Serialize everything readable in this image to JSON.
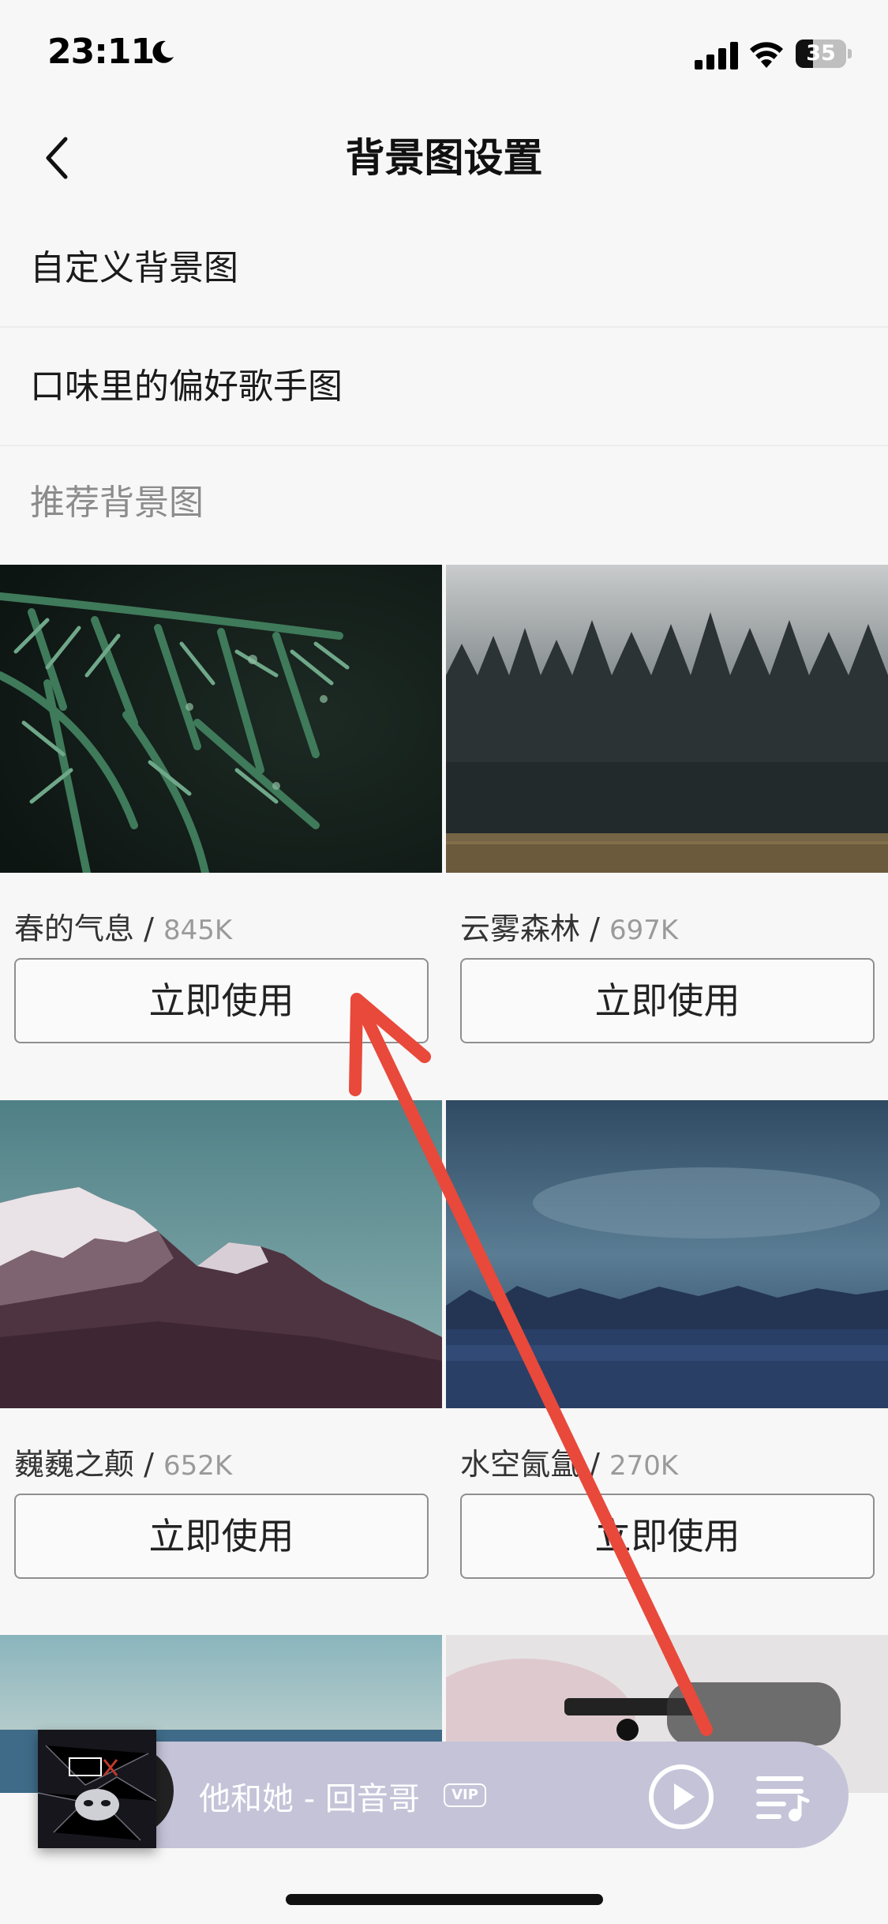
{
  "status_bar": {
    "time": "23:11",
    "battery": "35",
    "battery_level": 0.35
  },
  "header": {
    "title": "背景图设置",
    "back_icon": "chevron-left-icon"
  },
  "menu": {
    "custom_background": "自定义背景图",
    "preferred_singer": "口味里的偏好歌手图",
    "recommended_section": "推荐背景图"
  },
  "cards": [
    {
      "name": "春的气息",
      "separator": " / ",
      "size": "845K",
      "button": "立即使用"
    },
    {
      "name": "云雾森林",
      "separator": " / ",
      "size": "697K",
      "button": "立即使用"
    },
    {
      "name": "巍巍之颠",
      "separator": " / ",
      "size": "652K",
      "button": "立即使用"
    },
    {
      "name": "水空氤氲",
      "separator": " / ",
      "size": "270K",
      "button": "立即使用"
    }
  ],
  "player": {
    "song": "他和她 - 回音哥",
    "badge": "VIP",
    "play_icon": "play-circle-icon",
    "playlist_icon": "playlist-icon"
  },
  "colors": {
    "annotation_arrow": "#e8493b",
    "player_bg": "#c4c3d8"
  }
}
